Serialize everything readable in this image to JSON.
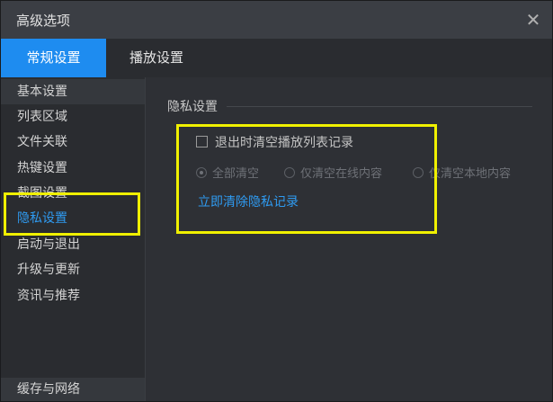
{
  "window": {
    "title": "高级选项"
  },
  "tabs": [
    {
      "label": "常规设置",
      "active": true
    },
    {
      "label": "播放设置",
      "active": false
    }
  ],
  "sidebar": {
    "items": [
      {
        "label": "基本设置"
      },
      {
        "label": "列表区域"
      },
      {
        "label": "文件关联"
      },
      {
        "label": "热键设置"
      },
      {
        "label": "截图设置"
      },
      {
        "label": "隐私设置",
        "selected": true
      },
      {
        "label": "启动与退出"
      },
      {
        "label": "升级与更新"
      },
      {
        "label": "资讯与推荐"
      }
    ],
    "bottom_item": "缓存与网络"
  },
  "privacy": {
    "section_title": "隐私设置",
    "clear_on_exit_label": "退出时清空播放列表记录",
    "clear_on_exit_checked": false,
    "radio_options": [
      {
        "label": "全部清空",
        "checked": true
      },
      {
        "label": "仅清空在线内容",
        "checked": false
      },
      {
        "label": "仅清空本地内容",
        "checked": false
      }
    ],
    "clear_now_link": "立即清除隐私记录"
  },
  "colors": {
    "accent": "#1e8cf0",
    "link": "#2f9af0",
    "highlight": "#f0f000"
  }
}
